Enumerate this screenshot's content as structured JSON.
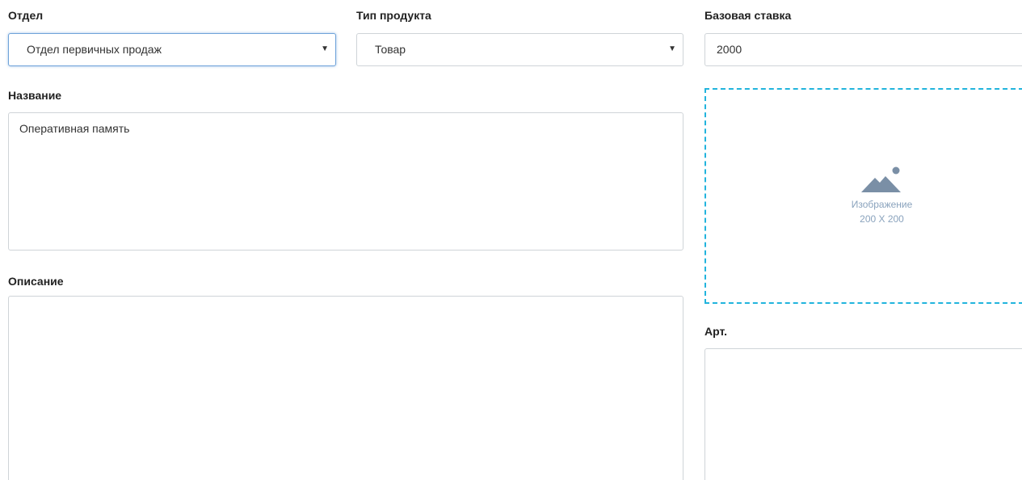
{
  "form": {
    "department": {
      "label": "Отдел",
      "value": "Отдел первичных продаж"
    },
    "product_type": {
      "label": "Тип продукта",
      "value": "Товар"
    },
    "base_rate": {
      "label": "Базовая ставка",
      "value": "2000"
    },
    "name": {
      "label": "Название",
      "value": "Оперативная память"
    },
    "description": {
      "label": "Описание",
      "value": ""
    },
    "image": {
      "line1": "Изображение",
      "line2": "200 X 200",
      "icon": "image-placeholder-icon"
    },
    "article": {
      "label": "Арт.",
      "value": ""
    }
  },
  "colors": {
    "dropzone_border": "#22b4dd",
    "focus_border": "#6fa3d9",
    "placeholder_icon": "#7a8fa6"
  }
}
